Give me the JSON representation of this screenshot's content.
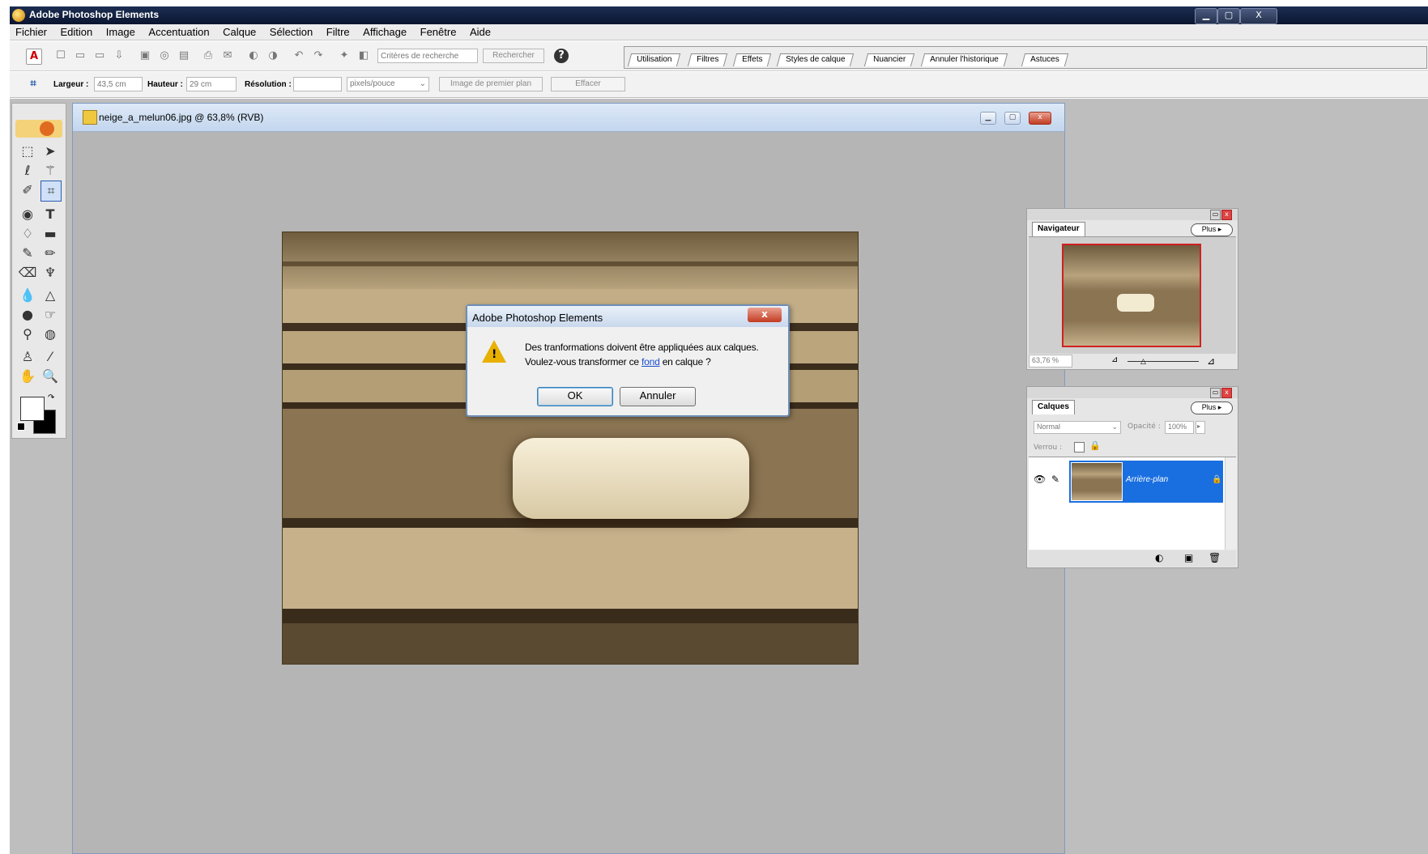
{
  "window": {
    "title": "Adobe Photoshop Elements"
  },
  "menu": [
    "Fichier",
    "Edition",
    "Image",
    "Accentuation",
    "Calque",
    "Sélection",
    "Filtre",
    "Affichage",
    "Fenêtre",
    "Aide"
  ],
  "toolbar": {
    "search_placeholder": "Critères de recherche",
    "search_button": "Rechercher",
    "palette_tabs": [
      "Utilisation",
      "Filtres",
      "Effets",
      "Styles de calque",
      "Nuancier",
      "Annuler l'historique",
      "Astuces"
    ]
  },
  "options": {
    "width_label": "Largeur :",
    "width_value": "43,5 cm",
    "height_label": "Hauteur :",
    "height_value": "29 cm",
    "resolution_label": "Résolution :",
    "resolution_value": "",
    "resolution_unit": "pixels/pouce",
    "front_image_button": "Image de premier plan",
    "clear_button": "Effacer"
  },
  "document": {
    "title": "neige_a_melun06.jpg @ 63,8% (RVB)"
  },
  "dialog": {
    "title": "Adobe Photoshop Elements",
    "line1": "Des tranformations doivent être appliquées aux calques.",
    "line2_before": "Voulez-vous transformer ce ",
    "line2_link": "fond",
    "line2_after": " en calque ?",
    "ok": "OK",
    "cancel": "Annuler"
  },
  "navigator": {
    "title": "Navigateur",
    "more": "Plus",
    "zoom": "63,76 %"
  },
  "layers": {
    "title": "Calques",
    "more": "Plus",
    "blend_mode": "Normal",
    "opacity_label": "Opacité :",
    "opacity_value": "100%",
    "lock_label": "Verrou :",
    "layer_name": "Arrière-plan"
  },
  "colors": {
    "accent_blue": "#1a6fe0",
    "photo_sepia": "#9a8563"
  }
}
